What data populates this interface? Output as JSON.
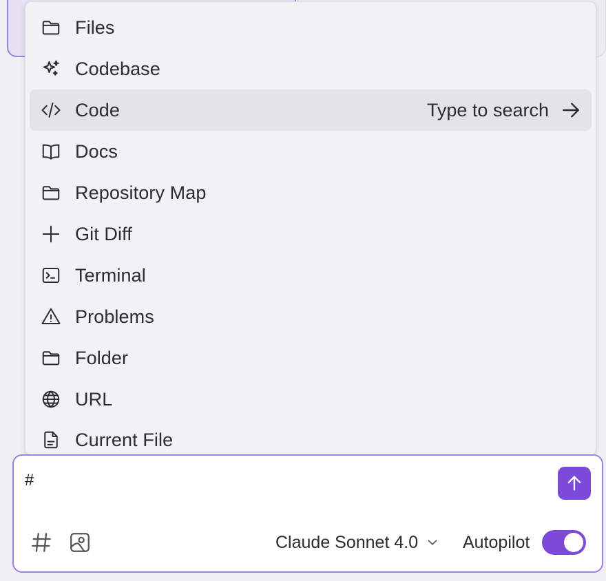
{
  "menu": {
    "items": [
      {
        "label": "Files",
        "icon": "folder-icon"
      },
      {
        "label": "Codebase",
        "icon": "sparkles-icon"
      },
      {
        "label": "Code",
        "icon": "code-icon",
        "hint": "Type to search",
        "active": true
      },
      {
        "label": "Docs",
        "icon": "book-icon"
      },
      {
        "label": "Repository Map",
        "icon": "folder-icon"
      },
      {
        "label": "Git Diff",
        "icon": "plus-icon"
      },
      {
        "label": "Terminal",
        "icon": "terminal-icon"
      },
      {
        "label": "Problems",
        "icon": "warning-icon"
      },
      {
        "label": "Folder",
        "icon": "folder-icon"
      },
      {
        "label": "URL",
        "icon": "globe-icon"
      },
      {
        "label": "Current File",
        "icon": "file-icon"
      }
    ]
  },
  "composer": {
    "input_value": "#",
    "model": "Claude Sonnet 4.0",
    "autopilot_label": "Autopilot",
    "autopilot_on": true,
    "send_icon": "arrow-up-icon",
    "tools": [
      "hash-icon",
      "image-icon"
    ]
  },
  "colors": {
    "accent": "#7c4ad8",
    "border_accent": "#9f7fe3",
    "menu_bg": "#f2f2f4",
    "active_item_bg": "#e4e3e8"
  }
}
